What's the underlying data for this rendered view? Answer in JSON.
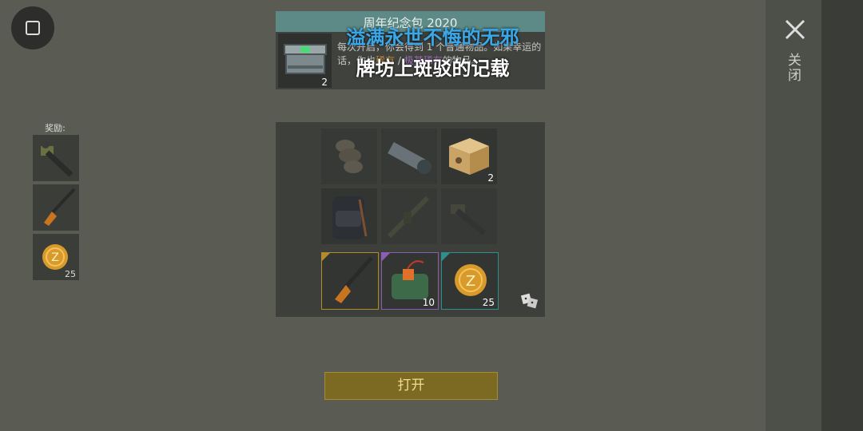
{
  "menu": {
    "icon": "square-menu-icon"
  },
  "close": {
    "label": "关闭",
    "icon": "close-x-icon"
  },
  "header": {
    "title": "周年纪念包 2020",
    "box_count": "2",
    "desc_part1": "每次开启，你会得到 1 个普通物品。如果幸运的话，你也",
    "desc_rare": "稀有",
    "desc_sep": " / ",
    "desc_epic": "极其稀有",
    "desc_end": "的物品。"
  },
  "overlay": {
    "line1": "溢满永世不悔的无邪",
    "line2": "牌坊上斑驳的记载"
  },
  "rewards": {
    "label": "奖励:",
    "items": [
      {
        "icon": "launcher-icon",
        "count": ""
      },
      {
        "icon": "rifle-icon",
        "count": ""
      },
      {
        "icon": "coin-icon",
        "count": "25"
      }
    ]
  },
  "grid": {
    "slots": [
      {
        "icon": "spring-parts-icon",
        "count": "",
        "state": "dim"
      },
      {
        "icon": "scope-icon",
        "count": "",
        "state": "dim"
      },
      {
        "icon": "cardboard-box-icon",
        "count": "2",
        "state": "normal"
      },
      {
        "icon": "backpack-icon",
        "count": "",
        "state": "normal"
      },
      {
        "icon": "assault-rifle-icon",
        "count": "",
        "state": "dim"
      },
      {
        "icon": "launcher-icon",
        "count": "",
        "state": "dim"
      },
      {
        "icon": "rifle-icon",
        "count": "",
        "state": "gold"
      },
      {
        "icon": "explosive-icon",
        "count": "10",
        "state": "purple"
      },
      {
        "icon": "coin-icon",
        "count": "25",
        "state": "teal"
      }
    ],
    "dice_icon": "dice-icon"
  },
  "open_button": {
    "label": "打开"
  },
  "colors": {
    "accent_gold": "#b58b2a",
    "accent_purple": "#8d5cb5",
    "accent_teal": "#2f8f8c",
    "title_bar": "#5d8a86"
  }
}
